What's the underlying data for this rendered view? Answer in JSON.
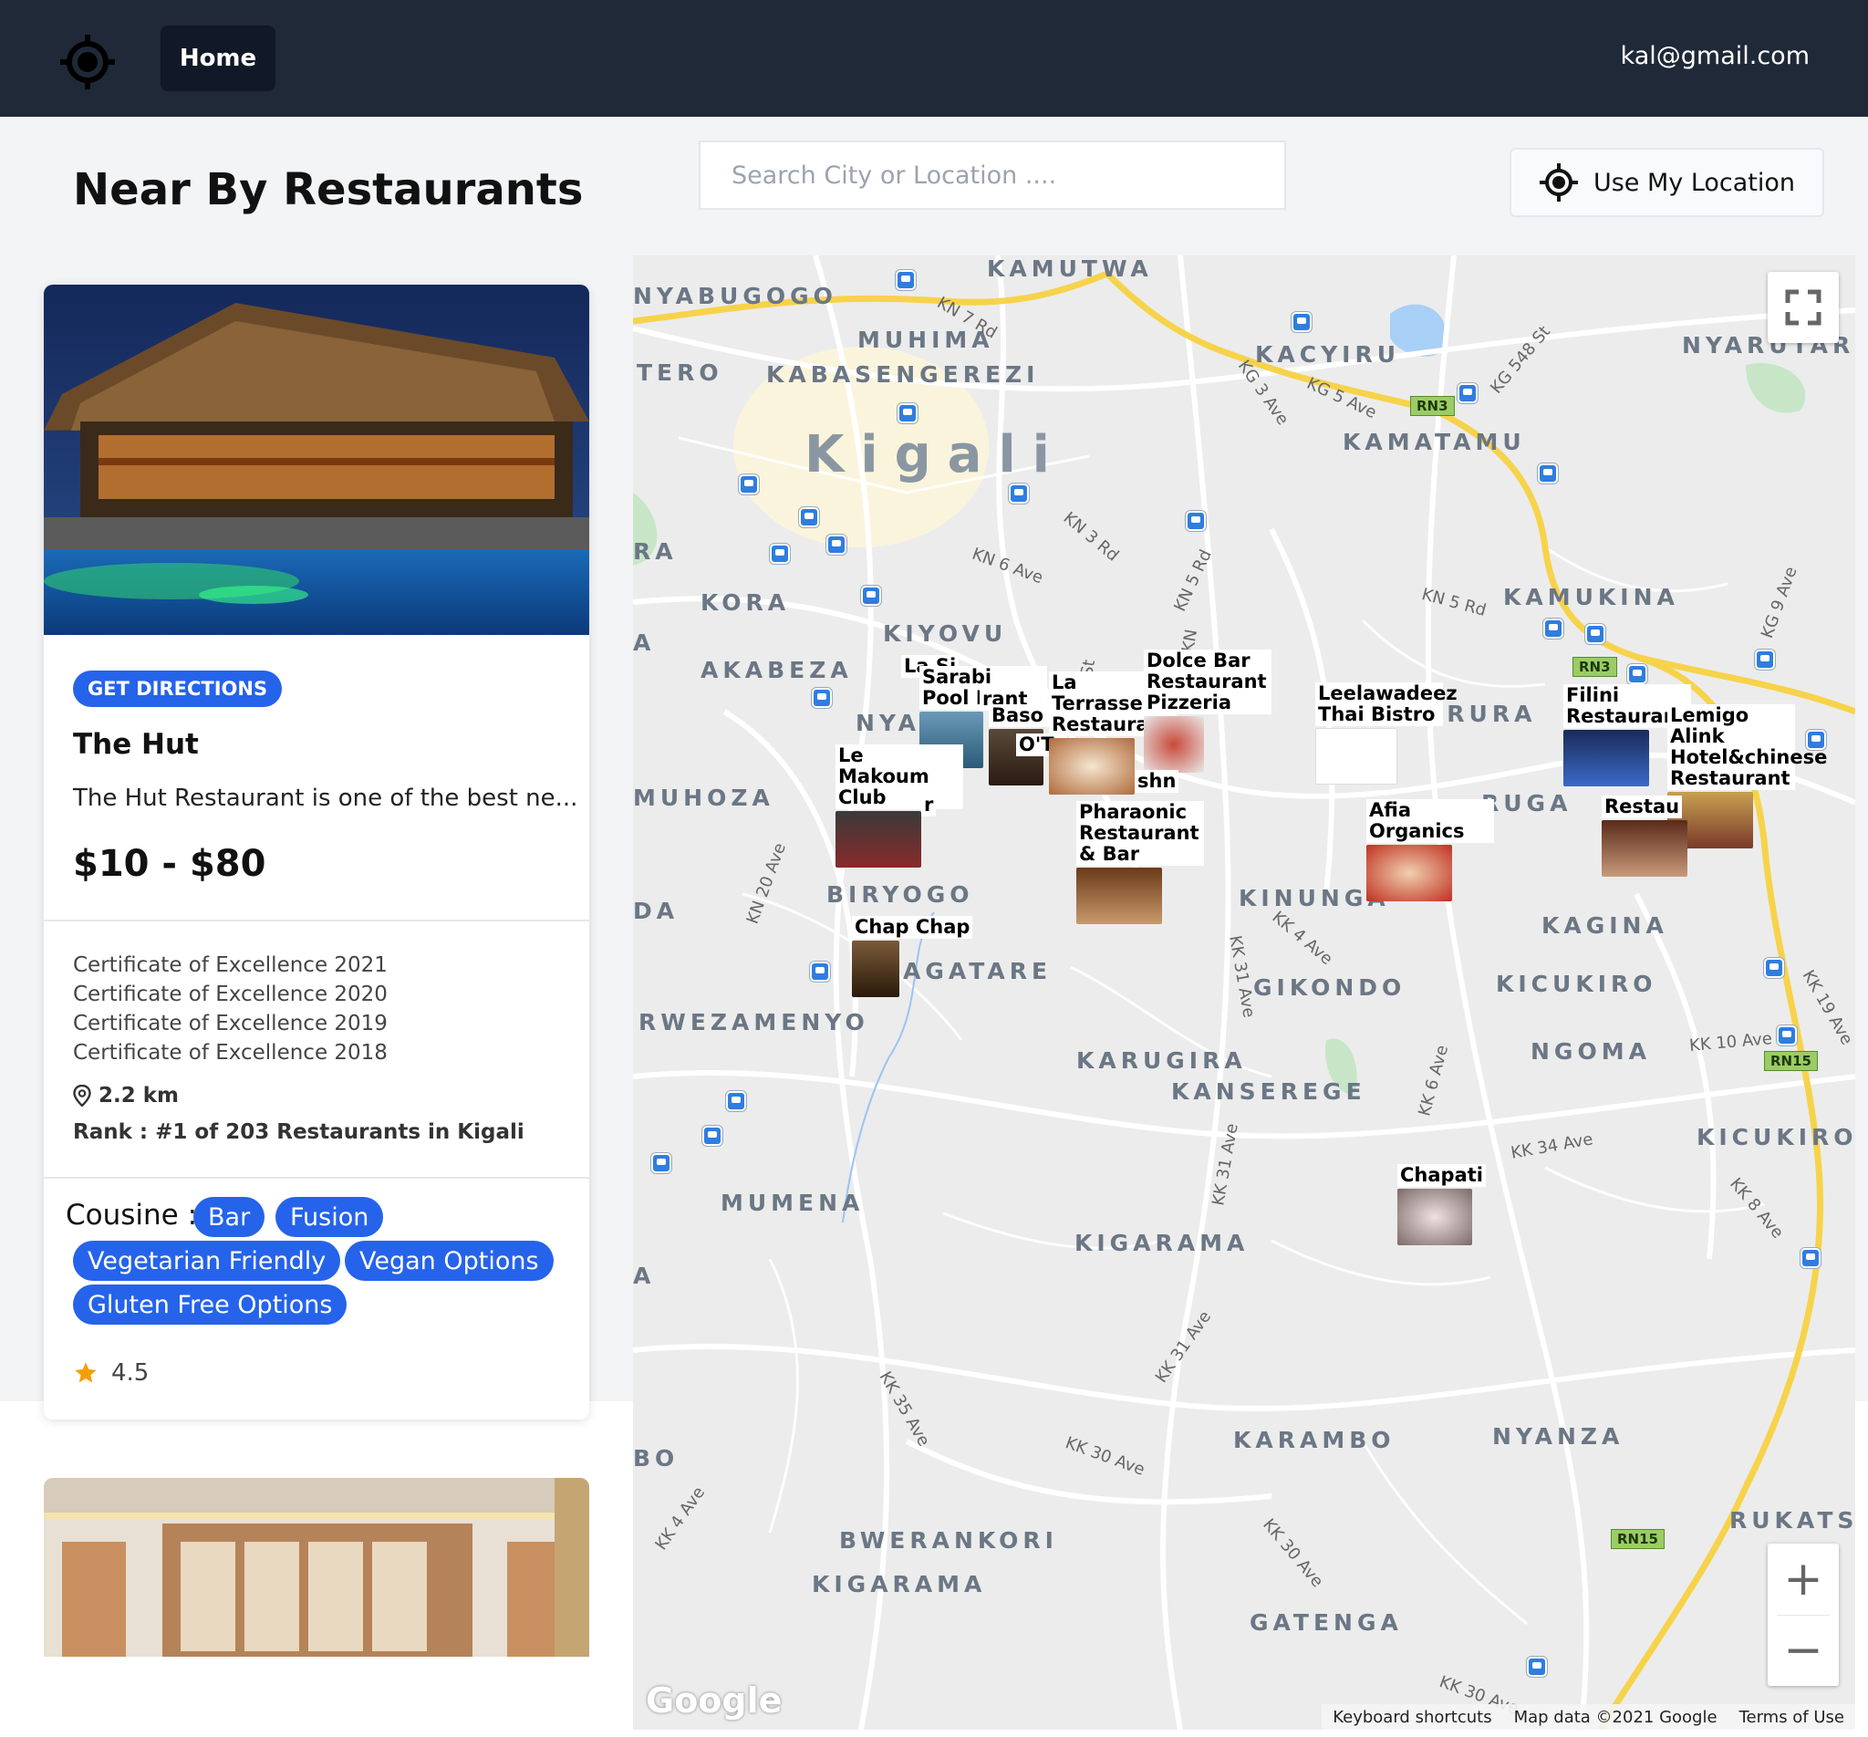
{
  "nav": {
    "home_label": "Home",
    "user_email": "kal@gmail.com"
  },
  "page": {
    "title": "Near By Restaurants"
  },
  "search": {
    "placeholder": "Search City or Location ...."
  },
  "location_button": {
    "label": "Use My Location"
  },
  "restaurants": [
    {
      "directions_label": "GET DIRECTIONS",
      "name": "The Hut",
      "description": "The Hut Restaurant is one of the best ne...",
      "price": "$10 - $80",
      "awards": [
        "Certificate of Excellence 2021",
        "Certificate of Excellence 2020",
        "Certificate of Excellence 2019",
        "Certificate of Excellence 2018"
      ],
      "distance": "2.2 km",
      "rank": "Rank : #1 of 203 Restaurants in Kigali",
      "cuisine_label": "Cousine :",
      "cuisines": [
        "Bar",
        "Fusion",
        "Vegetarian Friendly",
        "Vegan Options",
        "Gluten Free Options"
      ],
      "rating": "4.5"
    }
  ],
  "map": {
    "city": "Kigali",
    "areas": [
      "KAMUTWA",
      "NYABUGOGO",
      "MUHIMA",
      "KABASENGEREZI",
      "TERO",
      "KACYIRU",
      "NYARUTAR",
      "KAMATAMU",
      "RA",
      "KORA",
      "KIYOVU",
      "KAMUKINA",
      "AKABEZA",
      "NYA",
      "MUHOZA",
      "JRURA",
      "RUGA",
      "BIRYOGO",
      "KINUNGA",
      "KAGINA",
      "DA",
      "AGATARE",
      "GIKONDO",
      "KICUKIRO",
      "RWEZAMENYO",
      "NGOMA",
      "KARUGIRA",
      "KANSEREGE",
      "KICUKIRO",
      "MUMENA",
      "KIGARAMA",
      "KARAMBO",
      "NYANZA",
      "RUKATS",
      "BWERANKORI",
      "KIGARAMA",
      "GATENGA",
      "BO",
      "A",
      "A"
    ],
    "roads": [
      "KN 7 Rd",
      "KG 548 St",
      "KG 3 Ave",
      "KG 5 Ave",
      "KN 3 Rd",
      "KN 6 Ave",
      "KN 5 Rd",
      "KN 5 Rd",
      "KG 9 Ave",
      "KN 20 Ave",
      "KK 4 Ave",
      "KK 31 Ave",
      "KK 6 Ave",
      "KK 10 Ave",
      "KK 19 Ave",
      "KK 34 Ave",
      "KK 8 Ave",
      "KK 31 Ave",
      "KK 31 Ave",
      "KK 35 Ave",
      "KK 30 Ave",
      "KK 4 Ave",
      "KK 30 Ave",
      "KK 30 Ave",
      "St",
      "KN"
    ],
    "route_badges": [
      "RN3",
      "RN3",
      "RN15",
      "RN15"
    ],
    "markers": [
      "La Si",
      "Sarabi Pool Bar",
      "rant",
      "Baso Pa",
      "O'Ta",
      "La Terrasse Restaurant",
      "Dolce Bar Restaurant Pizzeria",
      "Le Makoum Club",
      "r",
      "shn",
      "Pharaonic Restaurant & Bar",
      "Leelawadeez Thai Bistro",
      "Afia Organics",
      "Filini Restaurant",
      "Lemigo Alink Hotel&chinese Restaurant",
      "Restau",
      "Chap Chap",
      "Chapati"
    ],
    "attribution": {
      "shortcuts": "Keyboard shortcuts",
      "data": "Map data ©2021 Google",
      "terms": "Terms of Use"
    },
    "google_logo": "Google"
  }
}
